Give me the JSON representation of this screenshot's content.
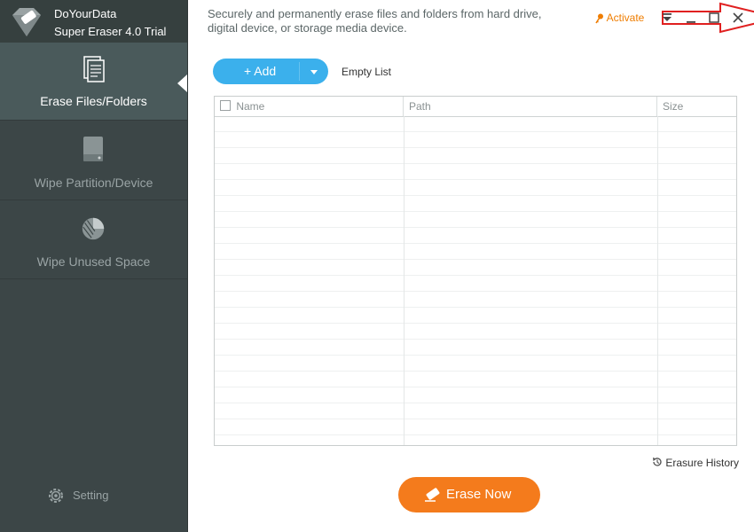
{
  "app": {
    "name": "DoYourData",
    "product": "Super Eraser 4.0 Trial"
  },
  "sidebar": {
    "items": [
      {
        "label": "Erase Files/Folders",
        "icon": "document-icon",
        "active": true
      },
      {
        "label": "Wipe Partition/Device",
        "icon": "drive-icon",
        "active": false
      },
      {
        "label": "Wipe Unused Space",
        "icon": "pie-chart-icon",
        "active": false
      }
    ],
    "setting_label": "Setting"
  },
  "header": {
    "description_line1": "Securely and permanently erase files and folders from hard drive,",
    "description_line2": "digital device, or storage media device.",
    "activate_label": "Activate"
  },
  "toolbar": {
    "add_label": "+  Add",
    "empty_list_label": "Empty List"
  },
  "table": {
    "columns": [
      "Name",
      "Path",
      "Size"
    ],
    "rows": []
  },
  "footer": {
    "history_label": "Erasure History",
    "erase_label": "Erase Now"
  },
  "colors": {
    "sidebar_bg": "#3c4647",
    "accent_blue": "#3bb0ec",
    "accent_orange": "#f47b1c",
    "annotation_red": "#e02020"
  }
}
